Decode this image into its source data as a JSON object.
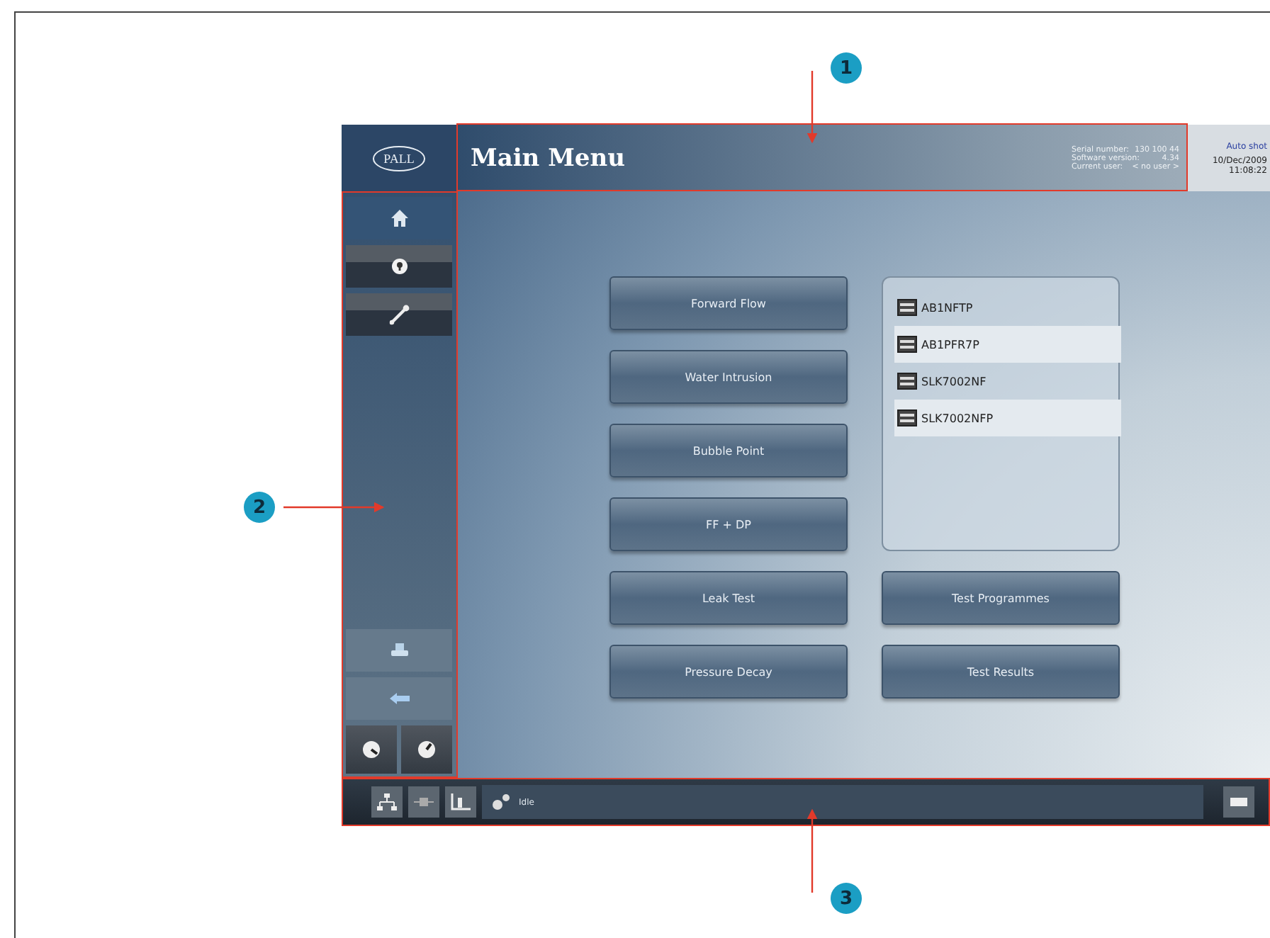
{
  "header": {
    "logo": "PALL",
    "title": "Main Menu",
    "info": [
      {
        "label": "Serial number:",
        "value": "130 100 44"
      },
      {
        "label": "Software version:",
        "value": "4.34"
      },
      {
        "label": "Current user:",
        "value": "< no user >"
      }
    ],
    "mode": "Auto shot",
    "date": "10/Dec/2009",
    "time": "11:08:22"
  },
  "tests": [
    "Forward Flow",
    "Water Intrusion",
    "Bubble Point",
    "FF + DP",
    "Leak Test",
    "Pressure Decay"
  ],
  "programmes": [
    "AB1NFTP",
    "AB1PFR7P",
    "SLK7002NF",
    "SLK7002NFP"
  ],
  "actions": [
    "Test Programmes",
    "Test Results"
  ],
  "status_bar": {
    "status": "Idle"
  },
  "callouts": [
    "1",
    "2",
    "3"
  ]
}
